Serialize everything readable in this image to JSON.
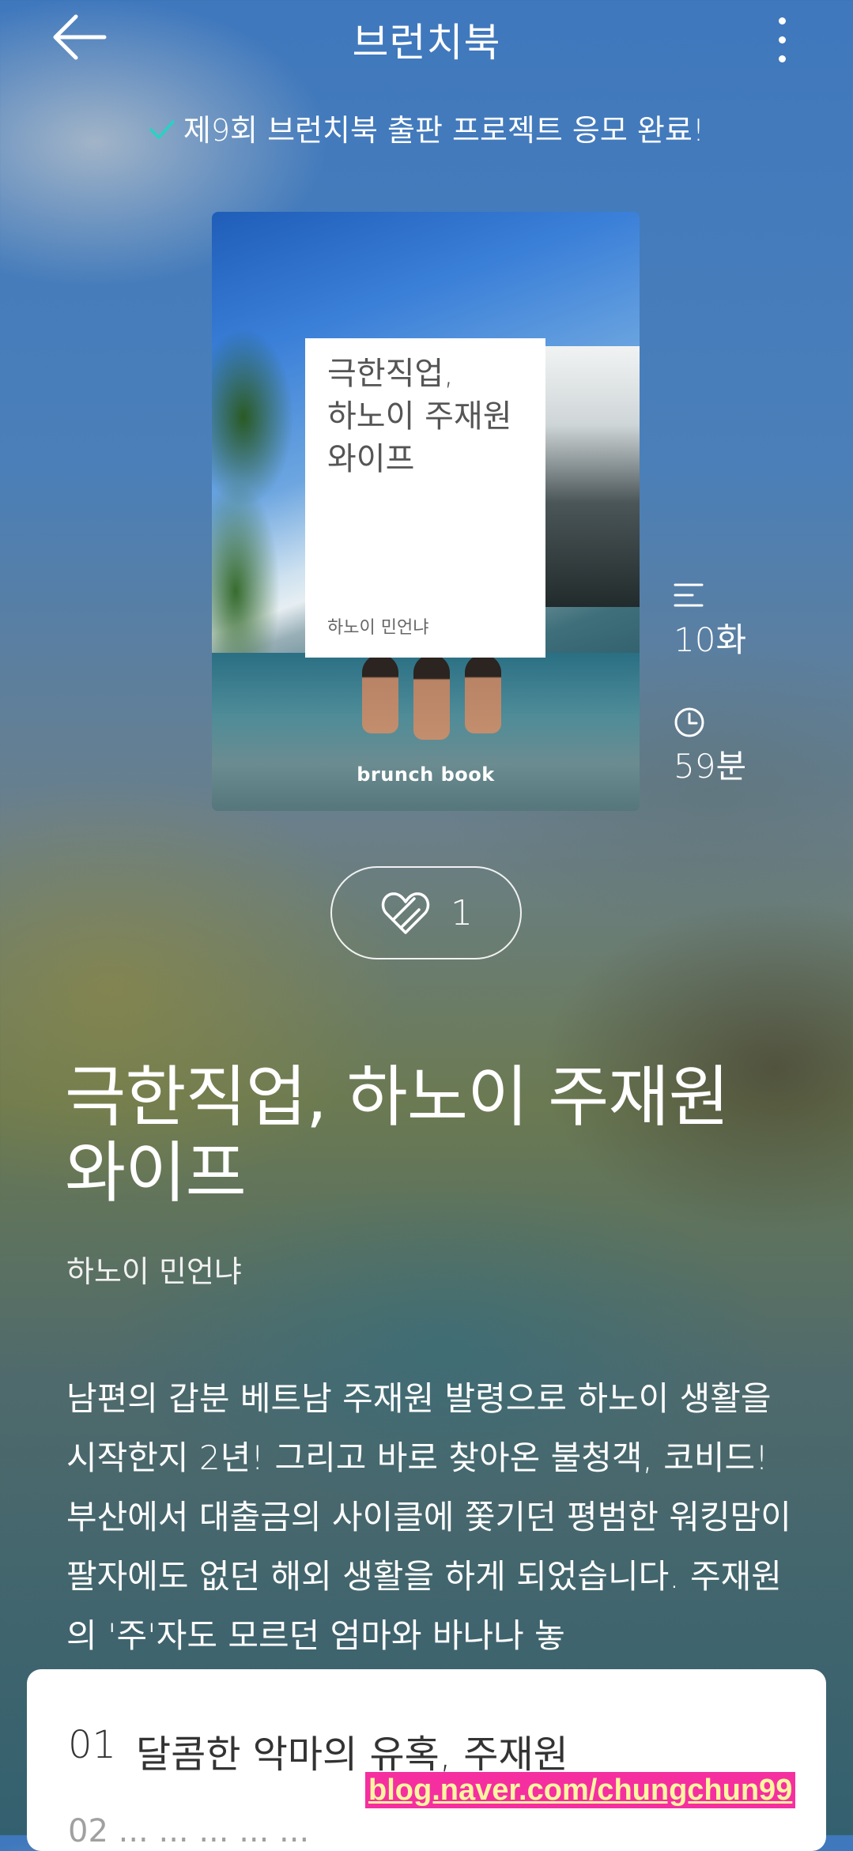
{
  "header": {
    "title": "브런치북"
  },
  "notice": {
    "text": "제9회 브런치북 출판 프로젝트 응모 완료!"
  },
  "cover": {
    "title": "극한직업,\n하노이 주재원\n와이프",
    "author": "하노이 민언냐",
    "brand": "brunch book"
  },
  "meta": {
    "episodes": "10화",
    "duration": "59분"
  },
  "likes": {
    "count": "1"
  },
  "book": {
    "title": "극한직업, 하노이 주재원 와이프",
    "author": "하노이 민언냐",
    "description": "남편의 갑분 베트남 주재원 발령으로 하노이 생활을 시작한지 2년! 그리고 바로 찾아온 불청객, 코비드! 부산에서 대출금의 사이클에 쫓기던 평범한 워킹맘이 팔자에도 없던 해외 생활을 하게 되었습니다. 주재원의 '주'자도 모르던 엄마와 바나나 놓"
  },
  "episode_list": [
    {
      "number": "01",
      "title": "달콤한 악마의 유혹, 주재원"
    }
  ],
  "episode_next_partial": "02 ... ... ... ... ...",
  "watermark": "blog.naver.com/chungchun99",
  "colors": {
    "accent_check": "#27d3c3",
    "watermark_bg": "#f52fa0",
    "watermark_text": "#fff6a0"
  },
  "icons": [
    "back-arrow-icon",
    "more-vertical-icon",
    "check-icon",
    "list-icon",
    "clock-icon",
    "like-icon"
  ]
}
